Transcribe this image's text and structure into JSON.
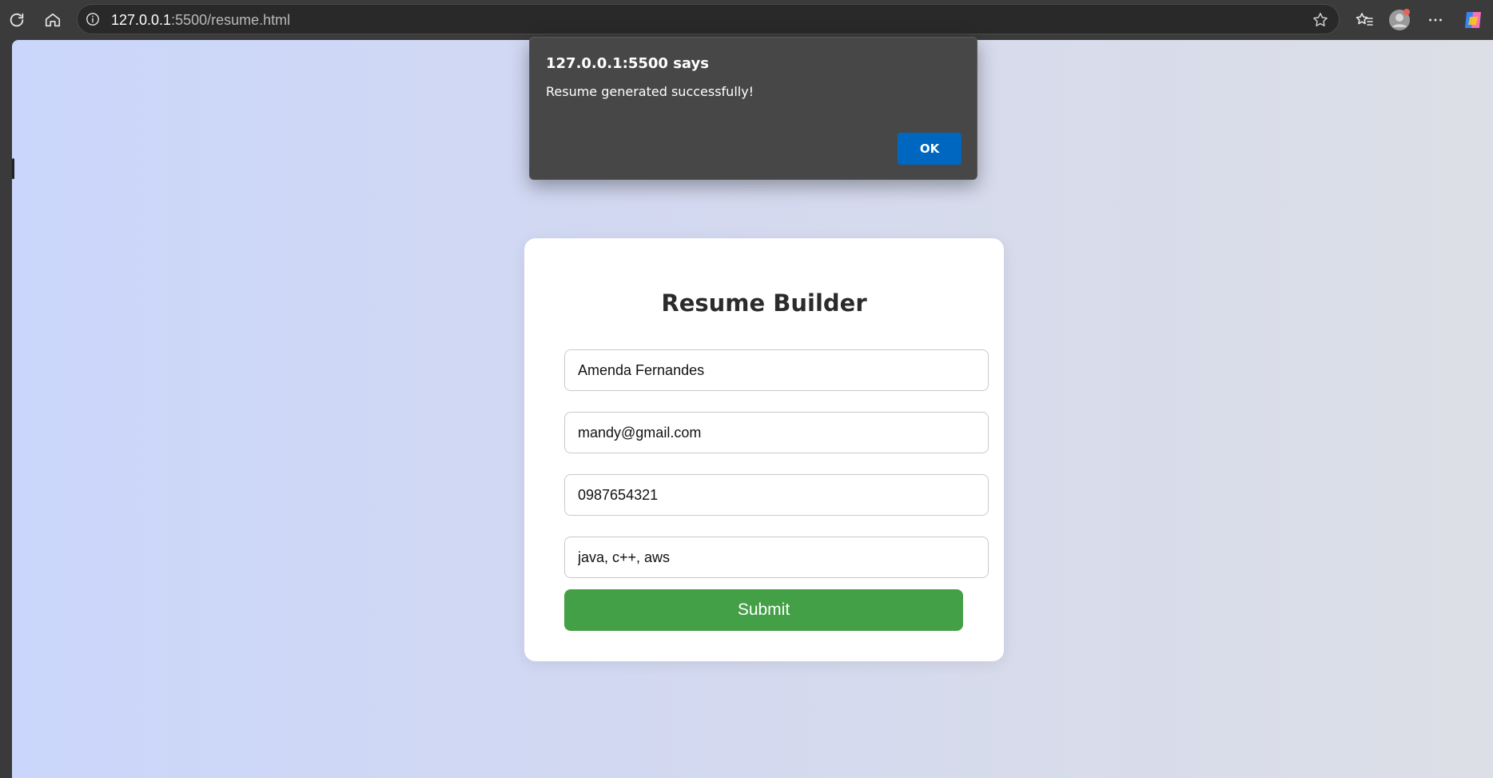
{
  "browser": {
    "url_host": "127.0.0.1",
    "url_path": ":5500/resume.html"
  },
  "dialog": {
    "title": "127.0.0.1:5500 says",
    "message": "Resume generated successfully!",
    "ok_label": "OK"
  },
  "form": {
    "title": "Resume Builder",
    "name_value": "Amenda Fernandes",
    "email_value": "mandy@gmail.com",
    "phone_value": "0987654321",
    "skills_value": "java, c++, aws",
    "submit_label": "Submit"
  },
  "colors": {
    "submit": "#44a047",
    "ok_button": "#0067c0",
    "dialog_bg": "#474747"
  }
}
